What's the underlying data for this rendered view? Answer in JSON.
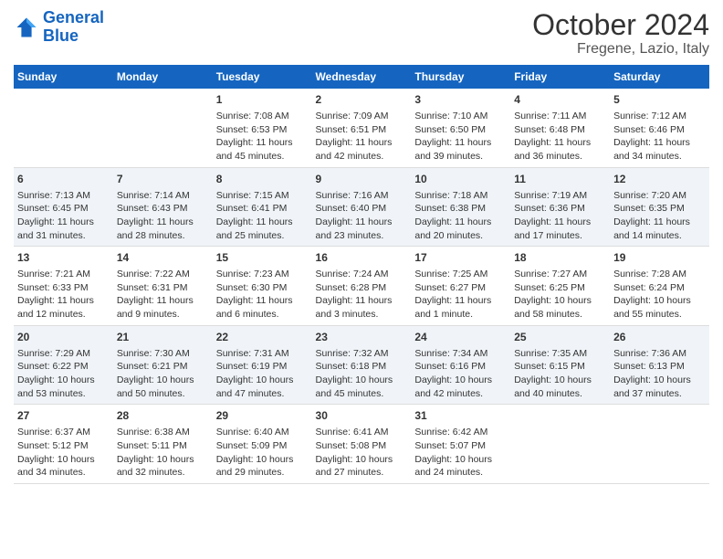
{
  "header": {
    "logo_line1": "General",
    "logo_line2": "Blue",
    "title": "October 2024",
    "subtitle": "Fregene, Lazio, Italy"
  },
  "weekdays": [
    "Sunday",
    "Monday",
    "Tuesday",
    "Wednesday",
    "Thursday",
    "Friday",
    "Saturday"
  ],
  "rows": [
    [
      {
        "day": "",
        "sunrise": "",
        "sunset": "",
        "daylight": ""
      },
      {
        "day": "",
        "sunrise": "",
        "sunset": "",
        "daylight": ""
      },
      {
        "day": "1",
        "sunrise": "Sunrise: 7:08 AM",
        "sunset": "Sunset: 6:53 PM",
        "daylight": "Daylight: 11 hours and 45 minutes."
      },
      {
        "day": "2",
        "sunrise": "Sunrise: 7:09 AM",
        "sunset": "Sunset: 6:51 PM",
        "daylight": "Daylight: 11 hours and 42 minutes."
      },
      {
        "day": "3",
        "sunrise": "Sunrise: 7:10 AM",
        "sunset": "Sunset: 6:50 PM",
        "daylight": "Daylight: 11 hours and 39 minutes."
      },
      {
        "day": "4",
        "sunrise": "Sunrise: 7:11 AM",
        "sunset": "Sunset: 6:48 PM",
        "daylight": "Daylight: 11 hours and 36 minutes."
      },
      {
        "day": "5",
        "sunrise": "Sunrise: 7:12 AM",
        "sunset": "Sunset: 6:46 PM",
        "daylight": "Daylight: 11 hours and 34 minutes."
      }
    ],
    [
      {
        "day": "6",
        "sunrise": "Sunrise: 7:13 AM",
        "sunset": "Sunset: 6:45 PM",
        "daylight": "Daylight: 11 hours and 31 minutes."
      },
      {
        "day": "7",
        "sunrise": "Sunrise: 7:14 AM",
        "sunset": "Sunset: 6:43 PM",
        "daylight": "Daylight: 11 hours and 28 minutes."
      },
      {
        "day": "8",
        "sunrise": "Sunrise: 7:15 AM",
        "sunset": "Sunset: 6:41 PM",
        "daylight": "Daylight: 11 hours and 25 minutes."
      },
      {
        "day": "9",
        "sunrise": "Sunrise: 7:16 AM",
        "sunset": "Sunset: 6:40 PM",
        "daylight": "Daylight: 11 hours and 23 minutes."
      },
      {
        "day": "10",
        "sunrise": "Sunrise: 7:18 AM",
        "sunset": "Sunset: 6:38 PM",
        "daylight": "Daylight: 11 hours and 20 minutes."
      },
      {
        "day": "11",
        "sunrise": "Sunrise: 7:19 AM",
        "sunset": "Sunset: 6:36 PM",
        "daylight": "Daylight: 11 hours and 17 minutes."
      },
      {
        "day": "12",
        "sunrise": "Sunrise: 7:20 AM",
        "sunset": "Sunset: 6:35 PM",
        "daylight": "Daylight: 11 hours and 14 minutes."
      }
    ],
    [
      {
        "day": "13",
        "sunrise": "Sunrise: 7:21 AM",
        "sunset": "Sunset: 6:33 PM",
        "daylight": "Daylight: 11 hours and 12 minutes."
      },
      {
        "day": "14",
        "sunrise": "Sunrise: 7:22 AM",
        "sunset": "Sunset: 6:31 PM",
        "daylight": "Daylight: 11 hours and 9 minutes."
      },
      {
        "day": "15",
        "sunrise": "Sunrise: 7:23 AM",
        "sunset": "Sunset: 6:30 PM",
        "daylight": "Daylight: 11 hours and 6 minutes."
      },
      {
        "day": "16",
        "sunrise": "Sunrise: 7:24 AM",
        "sunset": "Sunset: 6:28 PM",
        "daylight": "Daylight: 11 hours and 3 minutes."
      },
      {
        "day": "17",
        "sunrise": "Sunrise: 7:25 AM",
        "sunset": "Sunset: 6:27 PM",
        "daylight": "Daylight: 11 hours and 1 minute."
      },
      {
        "day": "18",
        "sunrise": "Sunrise: 7:27 AM",
        "sunset": "Sunset: 6:25 PM",
        "daylight": "Daylight: 10 hours and 58 minutes."
      },
      {
        "day": "19",
        "sunrise": "Sunrise: 7:28 AM",
        "sunset": "Sunset: 6:24 PM",
        "daylight": "Daylight: 10 hours and 55 minutes."
      }
    ],
    [
      {
        "day": "20",
        "sunrise": "Sunrise: 7:29 AM",
        "sunset": "Sunset: 6:22 PM",
        "daylight": "Daylight: 10 hours and 53 minutes."
      },
      {
        "day": "21",
        "sunrise": "Sunrise: 7:30 AM",
        "sunset": "Sunset: 6:21 PM",
        "daylight": "Daylight: 10 hours and 50 minutes."
      },
      {
        "day": "22",
        "sunrise": "Sunrise: 7:31 AM",
        "sunset": "Sunset: 6:19 PM",
        "daylight": "Daylight: 10 hours and 47 minutes."
      },
      {
        "day": "23",
        "sunrise": "Sunrise: 7:32 AM",
        "sunset": "Sunset: 6:18 PM",
        "daylight": "Daylight: 10 hours and 45 minutes."
      },
      {
        "day": "24",
        "sunrise": "Sunrise: 7:34 AM",
        "sunset": "Sunset: 6:16 PM",
        "daylight": "Daylight: 10 hours and 42 minutes."
      },
      {
        "day": "25",
        "sunrise": "Sunrise: 7:35 AM",
        "sunset": "Sunset: 6:15 PM",
        "daylight": "Daylight: 10 hours and 40 minutes."
      },
      {
        "day": "26",
        "sunrise": "Sunrise: 7:36 AM",
        "sunset": "Sunset: 6:13 PM",
        "daylight": "Daylight: 10 hours and 37 minutes."
      }
    ],
    [
      {
        "day": "27",
        "sunrise": "Sunrise: 6:37 AM",
        "sunset": "Sunset: 5:12 PM",
        "daylight": "Daylight: 10 hours and 34 minutes."
      },
      {
        "day": "28",
        "sunrise": "Sunrise: 6:38 AM",
        "sunset": "Sunset: 5:11 PM",
        "daylight": "Daylight: 10 hours and 32 minutes."
      },
      {
        "day": "29",
        "sunrise": "Sunrise: 6:40 AM",
        "sunset": "Sunset: 5:09 PM",
        "daylight": "Daylight: 10 hours and 29 minutes."
      },
      {
        "day": "30",
        "sunrise": "Sunrise: 6:41 AM",
        "sunset": "Sunset: 5:08 PM",
        "daylight": "Daylight: 10 hours and 27 minutes."
      },
      {
        "day": "31",
        "sunrise": "Sunrise: 6:42 AM",
        "sunset": "Sunset: 5:07 PM",
        "daylight": "Daylight: 10 hours and 24 minutes."
      },
      {
        "day": "",
        "sunrise": "",
        "sunset": "",
        "daylight": ""
      },
      {
        "day": "",
        "sunrise": "",
        "sunset": "",
        "daylight": ""
      }
    ]
  ]
}
